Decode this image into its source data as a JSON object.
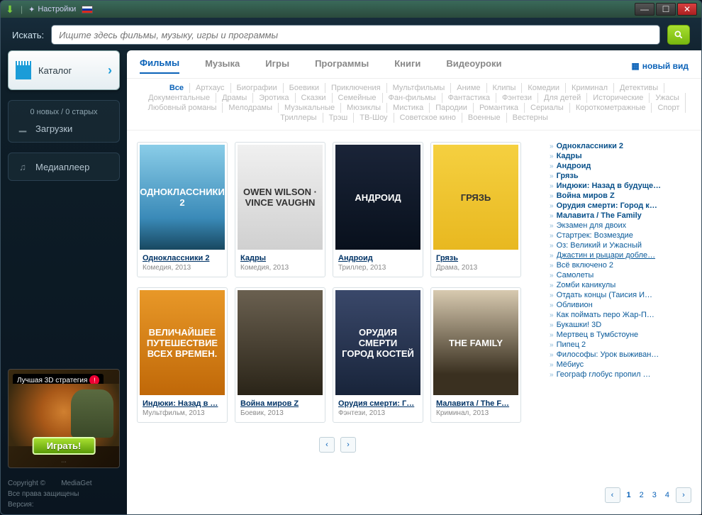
{
  "titlebar": {
    "settings": "Настройки"
  },
  "search": {
    "label": "Искать:",
    "placeholder": "Ищите здесь фильмы, музыку, игры и программы"
  },
  "sidebar": {
    "catalog": "Каталог",
    "dl_status": "0 новых / 0 старых",
    "downloads": "Загрузки",
    "player": "Медиаплеер"
  },
  "ad": {
    "banner": "Лучшая 3D стратегия",
    "play": "Играть!"
  },
  "footer": {
    "line1_a": "Copyright ©",
    "line1_b": "MediaGet",
    "line2": "Все права защищены",
    "line3": "Версия:"
  },
  "topnav": [
    "Фильмы",
    "Музыка",
    "Игры",
    "Программы",
    "Книги",
    "Видеоуроки"
  ],
  "newview": "новый вид",
  "genres": [
    "Все",
    "Артхаус",
    "Биографии",
    "Боевики",
    "Приключения",
    "Мультфильмы",
    "Аниме",
    "Клипы",
    "Комедии",
    "Криминал",
    "Детективы",
    "Документальные",
    "Драмы",
    "Эротика",
    "Сказки",
    "Семейные",
    "Фан-фильмы",
    "Фантастика",
    "Фэнтези",
    "Для детей",
    "Исторические",
    "Ужасы",
    "Любовный романы",
    "Мелодрамы",
    "Музыкальные",
    "Мюзиклы",
    "Мистика",
    "Пародии",
    "Романтика",
    "Сериалы",
    "Короткометражные",
    "Спорт",
    "Триллеры",
    "Трэш",
    "ТВ-Шоу",
    "Советское кино",
    "Военные",
    "Вестерны"
  ],
  "movies": [
    {
      "title": "Одноклассники 2",
      "meta": "Комедия, 2013",
      "poster_text": "ОДНОКЛАССНИКИ 2",
      "bg": "linear-gradient(180deg,#8acde8 0%,#3a8ab8 70%,#184860 100%)"
    },
    {
      "title": "Кадры",
      "meta": "Комедия, 2013",
      "poster_text": "OWEN WILSON · VINCE VAUGHN",
      "bg": "linear-gradient(180deg,#f0f0f0 0%,#d0d0d0 100%)",
      "dark": true
    },
    {
      "title": "Андроид",
      "meta": "Триллер, 2013",
      "poster_text": "АНДРОИД",
      "bg": "linear-gradient(180deg,#1a2438 0%,#08101c 100%)"
    },
    {
      "title": "Грязь",
      "meta": "Драма, 2013",
      "poster_text": "ГРЯЗЬ",
      "bg": "linear-gradient(180deg,#f5d040 0%,#e8b820 100%)",
      "dark": true
    },
    {
      "title": "Индюки: Назад в …",
      "meta": "Мультфильм, 2013",
      "poster_text": "ВЕЛИЧАЙШЕЕ ПУТЕШЕСТВИЕ ВСЕХ ВРЕМЕН.",
      "bg": "linear-gradient(180deg,#e89828 0%,#c06808 100%)"
    },
    {
      "title": "Война миров Z",
      "meta": "Боевик, 2013",
      "poster_text": "",
      "bg": "linear-gradient(180deg,#6a6050 0%,#2a2418 100%)"
    },
    {
      "title": "Орудия смерти: Г…",
      "meta": "Фэнтези, 2013",
      "poster_text": "ОРУДИЯ СМЕРТИ\\nГОРОД КОСТЕЙ",
      "bg": "linear-gradient(180deg,#3a486a 0%,#18243a 100%)"
    },
    {
      "title": "Малавита / The F…",
      "meta": "Криминал, 2013",
      "poster_text": "THE FAMILY",
      "bg": "linear-gradient(180deg,#d8cab0 0%,#3a3020 80%)"
    }
  ],
  "rightlist": [
    {
      "t": "Одноклассники 2",
      "b": true
    },
    {
      "t": "Кадры",
      "b": true
    },
    {
      "t": "Андроид",
      "b": true
    },
    {
      "t": "Грязь",
      "b": true
    },
    {
      "t": "Индюки: Назад в будуще…",
      "b": true
    },
    {
      "t": "Война миров Z",
      "b": true
    },
    {
      "t": "Орудия смерти: Город к…",
      "b": true
    },
    {
      "t": "Малавита / The Family",
      "b": true
    },
    {
      "t": "Экзамен для двоих"
    },
    {
      "t": "Стартрек: Возмездие"
    },
    {
      "t": "Оз: Великий и Ужасный"
    },
    {
      "t": "Джастин и рыцари добле…",
      "u": true
    },
    {
      "t": "Всё включено 2"
    },
    {
      "t": "Самолеты"
    },
    {
      "t": "Zомби каникулы"
    },
    {
      "t": "Отдать концы (Таисия И…"
    },
    {
      "t": "Обливион"
    },
    {
      "t": "Как поймать перо Жар-П…"
    },
    {
      "t": "Букашки! 3D"
    },
    {
      "t": "Мертвец в Тумбстоуне"
    },
    {
      "t": "Пипец 2"
    },
    {
      "t": "Философы: Урок выживан…"
    },
    {
      "t": "Мёбиус"
    },
    {
      "t": "Географ глобус пропил …"
    }
  ],
  "right_pages": [
    "1",
    "2",
    "3",
    "4"
  ]
}
